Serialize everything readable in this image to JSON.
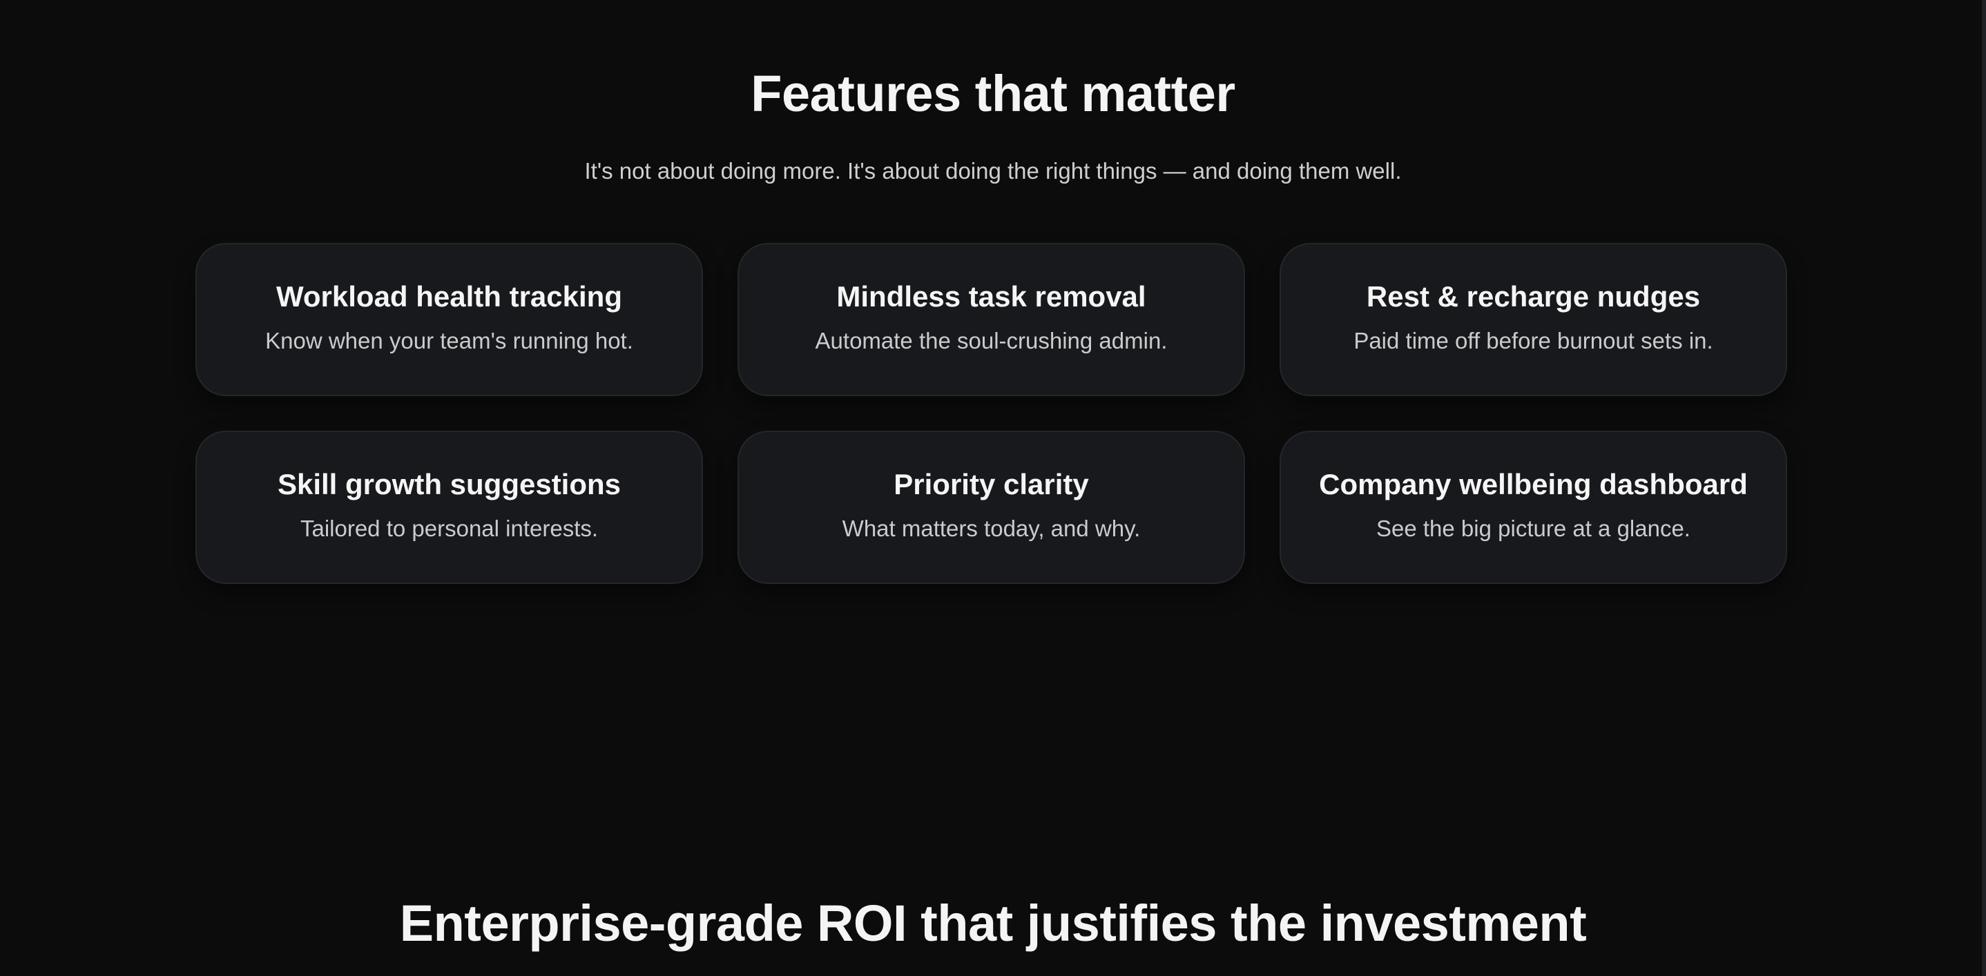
{
  "features": {
    "title": "Features that matter",
    "subtitle": "It's not about doing more. It's about doing the right things — and doing them well.",
    "cards": [
      {
        "title": "Workload health tracking",
        "description": "Know when your team's running hot."
      },
      {
        "title": "Mindless task removal",
        "description": "Automate the soul-crushing admin."
      },
      {
        "title": "Rest & recharge nudges",
        "description": "Paid time off before burnout sets in."
      },
      {
        "title": "Skill growth suggestions",
        "description": "Tailored to personal interests."
      },
      {
        "title": "Priority clarity",
        "description": "What matters today, and why."
      },
      {
        "title": "Company wellbeing dashboard",
        "description": "See the big picture at a glance."
      }
    ]
  },
  "roi": {
    "title": "Enterprise-grade ROI that justifies the investment"
  },
  "colors": {
    "page_background": "#0c0c0c",
    "card_background": "#18191c",
    "card_border": "#25262a",
    "heading_text": "#f4f4f4",
    "body_text": "#cbcbce"
  }
}
